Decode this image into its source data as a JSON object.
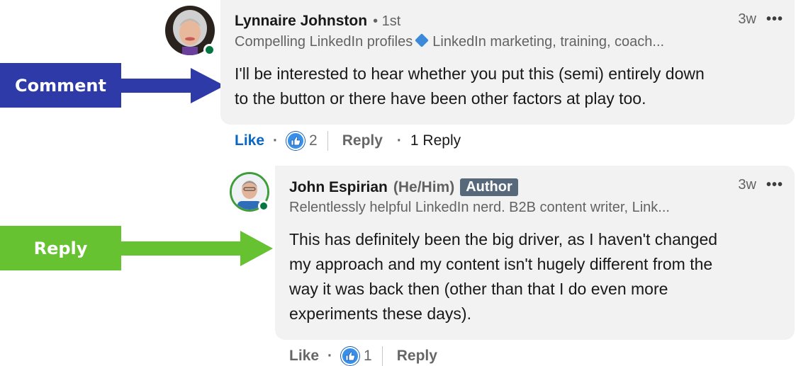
{
  "annotations": {
    "comment_label": "Comment",
    "reply_label": "Reply",
    "comment_color": "#2d3aa8",
    "reply_color": "#66c230"
  },
  "comment": {
    "author": "Lynnaire Johnston",
    "degree": "• 1st",
    "headline_part1": "Compelling LinkedIn profiles",
    "headline_part2": "LinkedIn marketing, training, coach...",
    "time": "3w",
    "more": "•••",
    "text_line1": "I'll be interested to hear whether you put this (semi) entirely down",
    "text_line2": "to the button or there have been other factors at play too.",
    "like_label": "Like",
    "separator": "·",
    "reaction_count": "2",
    "reply_label": "Reply",
    "replies_label": "1 Reply"
  },
  "reply": {
    "author": "John Espirian",
    "pronouns": "(He/Him)",
    "badge": "Author",
    "headline": "Relentlessly helpful LinkedIn nerd. B2B content writer, Link...",
    "time": "3w",
    "more": "•••",
    "text_line1": "This has definitely been the big driver, as I haven't changed",
    "text_line2": "my approach and my content isn't hugely different from the",
    "text_line3": "way it was back then (other than that I do even more",
    "text_line4": "experiments these days).",
    "like_label": "Like",
    "separator": "·",
    "reaction_count": "1",
    "reply_label": "Reply"
  },
  "colors": {
    "like_active": "#0a66c2",
    "presence": "#057642",
    "author_badge": "#56687a",
    "bubble": "#f2f2f2"
  },
  "icons": {
    "presence": "online-dot-icon",
    "reaction": "thumbs-up-icon",
    "more": "more-dots-icon"
  }
}
